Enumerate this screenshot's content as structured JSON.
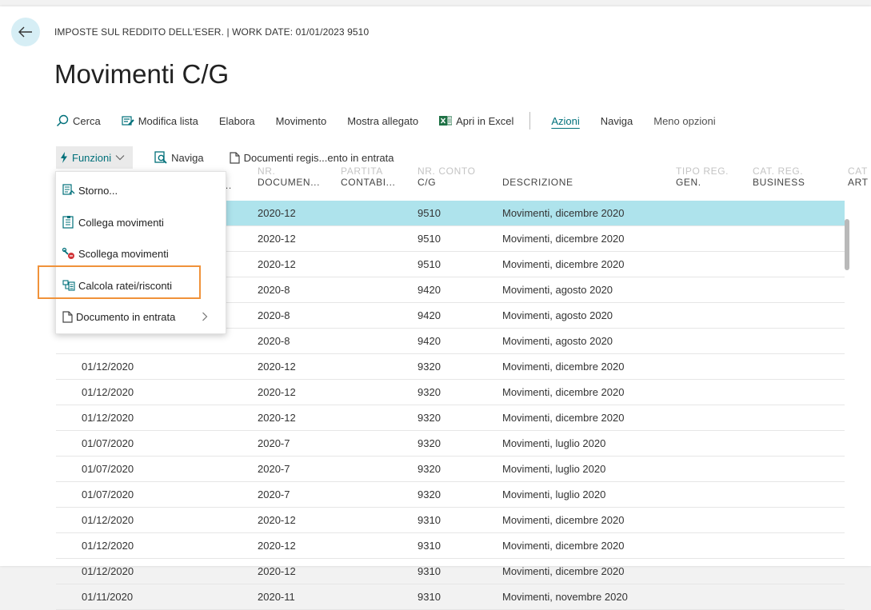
{
  "header": {
    "context": "IMPOSTE SUL REDDITO DELL'ESER. | WORK DATE: 01/01/2023 9510",
    "title": "Movimenti C/G"
  },
  "actions": [
    {
      "label": "Cerca",
      "icon": "search-icon"
    },
    {
      "label": "Modifica lista",
      "icon": "edit-list-icon"
    },
    {
      "label": "Elabora"
    },
    {
      "label": "Movimento"
    },
    {
      "label": "Mostra allegato"
    },
    {
      "label": "Apri in Excel",
      "icon": "excel-icon"
    },
    {
      "label": "Azioni"
    },
    {
      "label": "Naviga"
    },
    {
      "label": "Meno opzioni"
    }
  ],
  "subactions": [
    {
      "label": "Funzioni",
      "icon": "lightning-icon"
    },
    {
      "label": "Naviga",
      "icon": "navigate-icon"
    },
    {
      "label": "Documenti regis...ento in entrata",
      "icon": "document-icon"
    }
  ],
  "columns": {
    "c0": "...",
    "doc_top": "NR.",
    "doc": "DOCUMEN...",
    "ent_top": "PARTITA",
    "ent": "CONTABI...",
    "acc_top": "NR. CONTO",
    "acc": "C/G",
    "desc": "DESCRIZIONE",
    "gen_top": "TIPO REG.",
    "gen": "GEN.",
    "bus_top": "CAT. REG.",
    "bus": "BUSINESS",
    "art_top": "CAT",
    "art": "ART"
  },
  "menu": [
    {
      "label": "Storno...",
      "icon": "reverse-icon"
    },
    {
      "label": "Collega movimenti",
      "icon": "link-entries-icon"
    },
    {
      "label": "Scollega movimenti",
      "icon": "unlink-entries-icon"
    },
    {
      "label": "Calcola ratei/risconti",
      "icon": "calculate-accruals-icon"
    },
    {
      "label": "Documento in entrata",
      "icon": "document-icon"
    }
  ],
  "rows": [
    {
      "date": "",
      "doc": "2020-12",
      "acc": "9510",
      "desc": "Movimenti, dicembre 2020"
    },
    {
      "date": "",
      "doc": "2020-12",
      "acc": "9510",
      "desc": "Movimenti, dicembre 2020"
    },
    {
      "date": "",
      "doc": "2020-12",
      "acc": "9510",
      "desc": "Movimenti, dicembre 2020"
    },
    {
      "date": "",
      "doc": "2020-8",
      "acc": "9420",
      "desc": "Movimenti, agosto 2020"
    },
    {
      "date": "",
      "doc": "2020-8",
      "acc": "9420",
      "desc": "Movimenti, agosto 2020"
    },
    {
      "date": "",
      "doc": "2020-8",
      "acc": "9420",
      "desc": "Movimenti, agosto 2020"
    },
    {
      "date": "01/12/2020",
      "doc": "2020-12",
      "acc": "9320",
      "desc": "Movimenti, dicembre 2020"
    },
    {
      "date": "01/12/2020",
      "doc": "2020-12",
      "acc": "9320",
      "desc": "Movimenti, dicembre 2020"
    },
    {
      "date": "01/12/2020",
      "doc": "2020-12",
      "acc": "9320",
      "desc": "Movimenti, dicembre 2020"
    },
    {
      "date": "01/07/2020",
      "doc": "2020-7",
      "acc": "9320",
      "desc": "Movimenti, luglio 2020"
    },
    {
      "date": "01/07/2020",
      "doc": "2020-7",
      "acc": "9320",
      "desc": "Movimenti, luglio 2020"
    },
    {
      "date": "01/07/2020",
      "doc": "2020-7",
      "acc": "9320",
      "desc": "Movimenti, luglio 2020"
    },
    {
      "date": "01/12/2020",
      "doc": "2020-12",
      "acc": "9310",
      "desc": "Movimenti, dicembre 2020"
    },
    {
      "date": "01/12/2020",
      "doc": "2020-12",
      "acc": "9310",
      "desc": "Movimenti, dicembre 2020"
    },
    {
      "date": "01/12/2020",
      "doc": "2020-12",
      "acc": "9310",
      "desc": "Movimenti, dicembre 2020"
    },
    {
      "date": "01/11/2020",
      "doc": "2020-11",
      "acc": "9310",
      "desc": "Movimenti, novembre 2020"
    }
  ],
  "colors": {
    "accent": "#00707a",
    "selected_row": "#aee3ec",
    "highlight": "#f0923a"
  }
}
